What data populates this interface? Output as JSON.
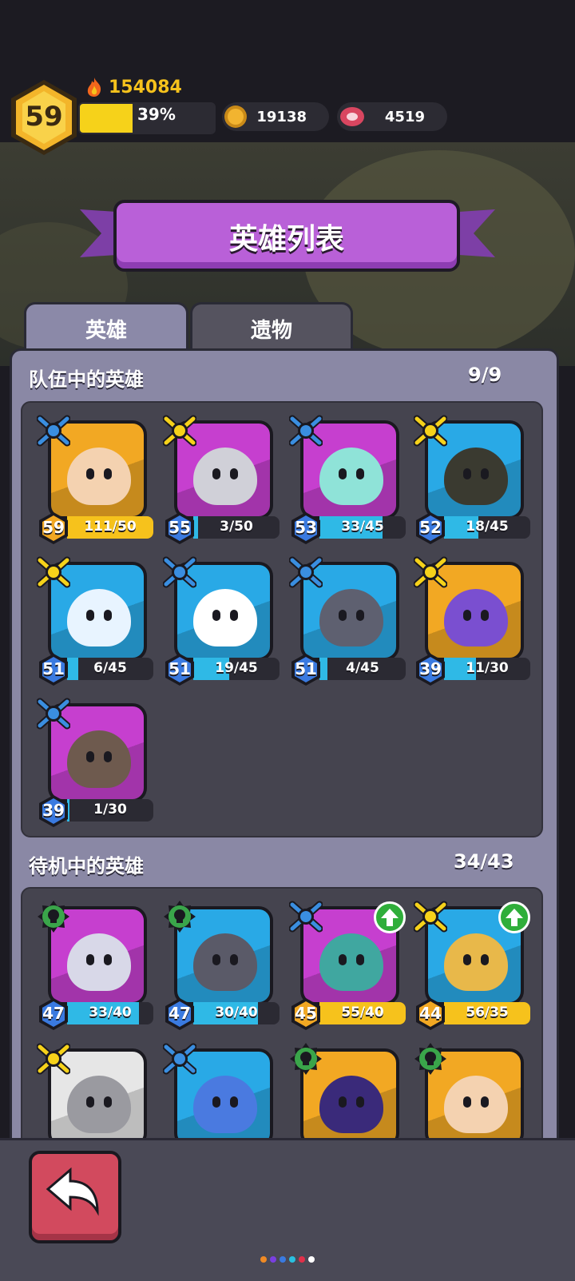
{
  "player": {
    "level": "59",
    "power": "154084",
    "xp_percent_label": "39%",
    "xp_fraction": 0.39
  },
  "resources": {
    "gold": "19138",
    "meat": "4519"
  },
  "title": "英雄列表",
  "tabs": [
    {
      "label": "英雄",
      "active": true
    },
    {
      "label": "遗物",
      "active": false
    }
  ],
  "team": {
    "title": "队伍中的英雄",
    "count": "9/9",
    "heroes": [
      {
        "level": "59",
        "progress": "111/50",
        "badge": "blue-star",
        "bg": "#f2a823",
        "fill": "#f6c21c",
        "ratio": 1.0
      },
      {
        "level": "55",
        "progress": "3/50",
        "badge": "gold-star",
        "bg": "#c63fcf",
        "fill": "#2fb9e6",
        "ratio": 0.06
      },
      {
        "level": "53",
        "progress": "33/45",
        "badge": "blue-star",
        "bg": "#c63fcf",
        "fill": "#2fb9e6",
        "ratio": 0.73
      },
      {
        "level": "52",
        "progress": "18/45",
        "badge": "gold-star",
        "bg": "#29a9e6",
        "fill": "#2fb9e6",
        "ratio": 0.4
      },
      {
        "level": "51",
        "progress": "6/45",
        "badge": "gold-star",
        "bg": "#29a9e6",
        "fill": "#2fb9e6",
        "ratio": 0.13
      },
      {
        "level": "51",
        "progress": "19/45",
        "badge": "blue-star",
        "bg": "#29a9e6",
        "fill": "#2fb9e6",
        "ratio": 0.42
      },
      {
        "level": "51",
        "progress": "4/45",
        "badge": "blue-star",
        "bg": "#29a9e6",
        "fill": "#2fb9e6",
        "ratio": 0.09
      },
      {
        "level": "39",
        "progress": "11/30",
        "badge": "gold-star",
        "bg": "#f2a823",
        "fill": "#2fb9e6",
        "ratio": 0.37
      },
      {
        "level": "39",
        "progress": "1/30",
        "badge": "blue-star",
        "bg": "#c63fcf",
        "fill": "#2fb9e6",
        "ratio": 0.03
      }
    ]
  },
  "standby": {
    "title": "待机中的英雄",
    "count": "34/43",
    "heroes": [
      {
        "level": "47",
        "progress": "33/40",
        "badge": "green-skull",
        "bg": "#c63fcf",
        "fill": "#2fb9e6",
        "ratio": 0.83,
        "upgrade": false
      },
      {
        "level": "47",
        "progress": "30/40",
        "badge": "green-skull",
        "bg": "#29a9e6",
        "fill": "#2fb9e6",
        "ratio": 0.75,
        "upgrade": false
      },
      {
        "level": "45",
        "progress": "55/40",
        "badge": "blue-star",
        "bg": "#c63fcf",
        "fill": "#f6c21c",
        "ratio": 1.0,
        "upgrade": true
      },
      {
        "level": "44",
        "progress": "56/35",
        "badge": "gold-star",
        "bg": "#29a9e6",
        "fill": "#f6c21c",
        "ratio": 1.0,
        "upgrade": true
      },
      {
        "level": "",
        "progress": "",
        "badge": "gold-star",
        "bg": "#e6e6e6",
        "fill": "#2fb9e6",
        "ratio": 0,
        "upgrade": false
      },
      {
        "level": "",
        "progress": "",
        "badge": "blue-star",
        "bg": "#29a9e6",
        "fill": "#2fb9e6",
        "ratio": 0,
        "upgrade": false
      },
      {
        "level": "",
        "progress": "",
        "badge": "green-skull",
        "bg": "#f2a823",
        "fill": "#2fb9e6",
        "ratio": 0,
        "upgrade": false
      },
      {
        "level": "",
        "progress": "",
        "badge": "green-skull",
        "bg": "#f2a823",
        "fill": "#2fb9e6",
        "ratio": 0,
        "upgrade": false
      }
    ]
  },
  "colors": {
    "accent_purple": "#b960d8",
    "gold": "#f6c21c",
    "cyan": "#2fb9e6",
    "back_red": "#d24a5e"
  },
  "icons": {
    "back": "back-arrow-icon",
    "power": "flame-icon",
    "gold": "coin-icon",
    "meat": "meat-icon"
  }
}
